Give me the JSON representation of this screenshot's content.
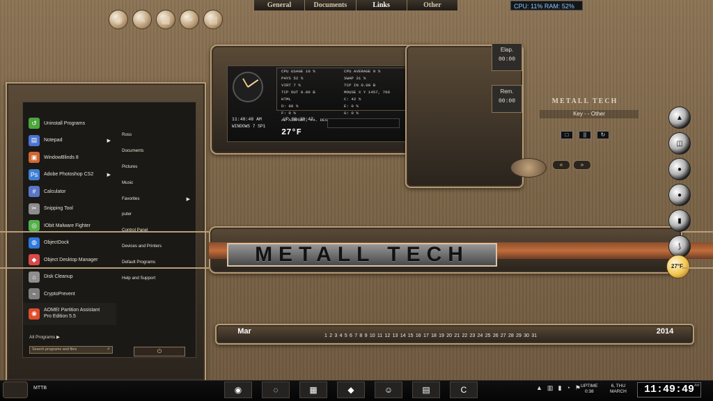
{
  "top_links": {
    "items": [
      "General",
      "Documents",
      "Links",
      "Other"
    ],
    "active": "Links"
  },
  "system_monitor": {
    "cpu": "CPU: 11%",
    "ram": "RAM: 52%"
  },
  "top_dock_icons": [
    "chrome-icon",
    "paint-icon",
    "calendar-icon",
    "feather-icon",
    "books-icon"
  ],
  "info_panel": {
    "time": "11:48:48 AM",
    "windows": "WINDOWS 7 SP1",
    "uptime": "UP 00:38:47",
    "temperature": "27°F",
    "stats": [
      "CPU USAGE 10 %",
      "CPU AVERAGE 9 %",
      "PHYS 52 %",
      "SWAP 31 %",
      "VIRT 7 %",
      "TCP IN 0.00 B",
      "TCP OUT 0.00 B",
      "MOUSE X Y 1457, 766",
      "HTML",
      "C: 42 %",
      "D: 88 %",
      "E: 0 %",
      "F: 0 %",
      "G: 0 %",
      "AL AIRPORT, PA. DESCRIPTION: OVERCAST"
    ]
  },
  "media_player": {
    "elap_label": "Elap.",
    "elap_value": "00:00",
    "rem_label": "Rem.",
    "rem_value": "00:00",
    "title": "METALL TECH",
    "subtitle": "Key - - Other",
    "controls": [
      "□",
      "||",
      "↻"
    ],
    "prev_label": "«",
    "next_label": "»"
  },
  "start_menu": {
    "programs": [
      {
        "label": "Uninstall Programs",
        "icon": "uninstall-icon",
        "color": "#4ea53b"
      },
      {
        "label": "Notepad",
        "icon": "notepad-icon",
        "color": "#4b73d1",
        "arrow": true
      },
      {
        "label": "WindowBlinds 8",
        "icon": "windowblinds-icon",
        "color": "#d16633"
      },
      {
        "label": "Adobe Photoshop CS2",
        "icon": "photoshop-icon",
        "color": "#3e7fd6",
        "arrow": true
      },
      {
        "label": "Calculator",
        "icon": "calculator-icon",
        "color": "#5a75c7"
      },
      {
        "label": "Snipping Tool",
        "icon": "snipping-icon",
        "color": "#8d8d8d"
      },
      {
        "label": "IObit Malware Fighter",
        "icon": "iobit-icon",
        "color": "#54b04a"
      },
      {
        "label": "ObjectDock",
        "icon": "objectdock-icon",
        "color": "#2f78dd"
      },
      {
        "label": "Object Desktop Manager",
        "icon": "object-desktop-icon",
        "color": "#d84848"
      },
      {
        "label": "Disk Cleanup",
        "icon": "disk-cleanup-icon",
        "color": "#8e8e8e"
      },
      {
        "label": "CryptoPrevent",
        "icon": "cryptoprevent-icon",
        "color": "#7f7f7f"
      }
    ],
    "last_program_line1": "AOMEI Partition Assistant",
    "last_program_line2": "Pro Edition 5.5",
    "all_programs": "All Programs",
    "search_placeholder": "Search programs and files",
    "right_links": [
      "Ross",
      "Documents",
      "Pictures",
      "Music",
      "Favorites",
      "puter",
      "Control Panel",
      "Devices and Printers",
      "Default Programs",
      "Help and Support"
    ],
    "power_label": "⏻"
  },
  "banner": {
    "text": "METALL TECH"
  },
  "right_dock": [
    "dock-item-1",
    "dock-item-2",
    "dock-item-3",
    "dock-item-4",
    "dock-item-5",
    "dock-item-6"
  ],
  "weather": {
    "temp": "27°F"
  },
  "calendar": {
    "month": "Mar",
    "year": "2014",
    "days": [
      "1",
      "2",
      "3",
      "4",
      "5",
      "6",
      "7",
      "8",
      "9",
      "10",
      "11",
      "12",
      "13",
      "14",
      "15",
      "16",
      "17",
      "18",
      "19",
      "20",
      "21",
      "22",
      "23",
      "24",
      "25",
      "26",
      "27",
      "28",
      "29",
      "30",
      "31"
    ]
  },
  "taskbar": {
    "label": "MTTB",
    "uptime_label": "UPTIME",
    "uptime_value": "0:38",
    "date_line1": "6, THU",
    "date_line2": "MARCH",
    "clock": "11:49:49",
    "ampm": "AM",
    "task_icons": [
      "chrome-task-icon",
      "firefox-task-icon",
      "explorer-task-icon",
      "app-task-icon",
      "theme-task-icon",
      "notepad-task-icon",
      "ccleaner-task-icon"
    ]
  }
}
